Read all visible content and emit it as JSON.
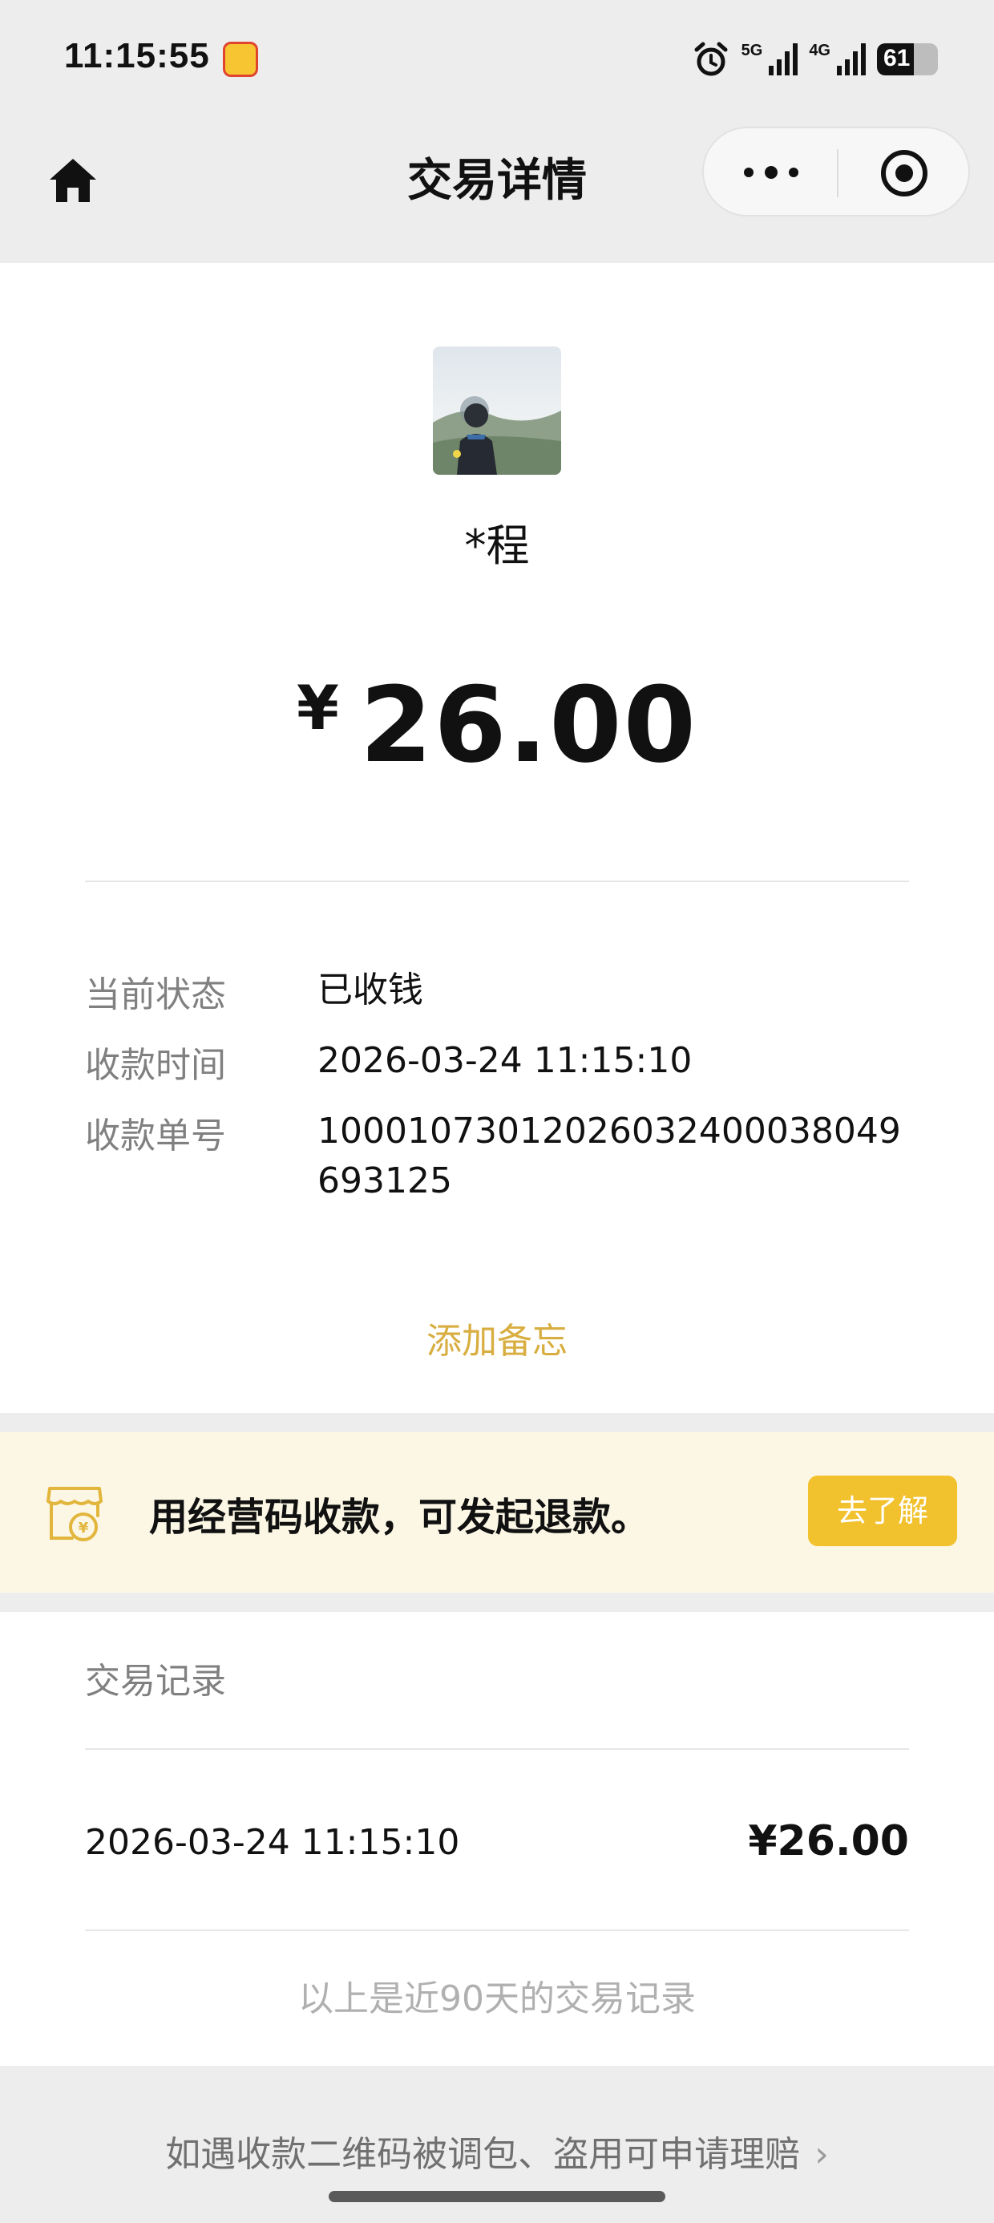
{
  "status_bar": {
    "time": "11:15:55",
    "network_5g": "5G",
    "network_4g": "4G",
    "battery": "61",
    "battery_level": 0.61,
    "icons": [
      "app-badge-icon",
      "alarm-clock-icon",
      "signal-5g-icon",
      "signal-4g-icon",
      "battery-icon"
    ]
  },
  "nav": {
    "title": "交易详情",
    "home_icon": "home-icon",
    "more_icon": "more-dots-icon",
    "close_icon": "target-circle-icon"
  },
  "payer": {
    "name": "*程"
  },
  "amount": {
    "symbol": "¥",
    "value": "26.00"
  },
  "details": {
    "status_label": "当前状态",
    "status_value": "已收钱",
    "time_label": "收款时间",
    "time_value": "2026-03-24 11:15:10",
    "order_label": "收款单号",
    "order_value": "10001073012026032400038049693125"
  },
  "add_memo_label": "添加备忘",
  "banner": {
    "text": "用经营码收款，可发起退款。",
    "button_label": "去了解",
    "icon": "shop-yuan-icon",
    "accent_color": "#f2c12e"
  },
  "records": {
    "title": "交易记录",
    "items": [
      {
        "time": "2026-03-24 11:15:10",
        "amount": "¥26.00"
      }
    ],
    "footer": "以上是近90天的交易记录"
  },
  "claim_link": {
    "text": "如遇收款二维码被调包、盗用可申请理赔",
    "chevron": "›"
  },
  "colors": {
    "memo": "#d8ae40",
    "banner_bg": "#fcf7e5",
    "page_bg": "#ededed"
  }
}
